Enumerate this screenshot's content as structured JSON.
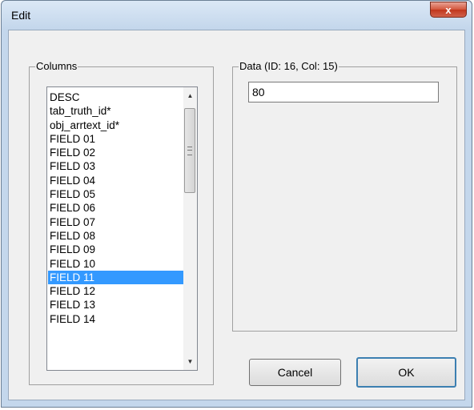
{
  "window": {
    "title": "Edit",
    "close_label": "x"
  },
  "columns_group": {
    "title": "Columns",
    "items": [
      "DESC",
      "tab_truth_id*",
      "obj_arrtext_id*",
      "FIELD 01",
      "FIELD 02",
      "FIELD 03",
      "FIELD 04",
      "FIELD 05",
      "FIELD 06",
      "FIELD 07",
      "FIELD 08",
      "FIELD 09",
      "FIELD 10",
      "FIELD 11",
      "FIELD 12",
      "FIELD 13",
      "FIELD 14"
    ],
    "selected_item": "FIELD 11",
    "scroll_up_icon": "triangle-up-icon",
    "scroll_down_icon": "triangle-down-icon"
  },
  "data_group": {
    "title": "Data (ID: 16, Col: 15)",
    "value": "80"
  },
  "buttons": {
    "cancel": "Cancel",
    "ok": "OK"
  },
  "colors": {
    "selection": "#3399ff",
    "close_button": "#c9472d",
    "dialog_background": "#f0f0f0"
  }
}
